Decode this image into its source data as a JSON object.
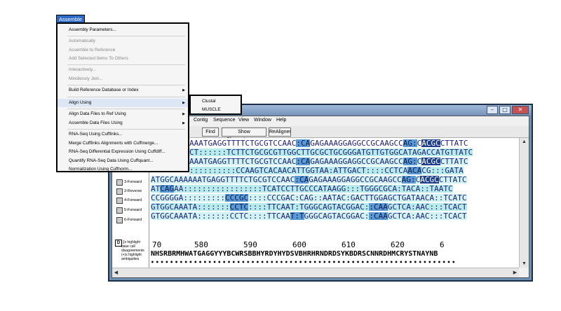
{
  "window": {
    "controls": {
      "minimize": "–",
      "maximize": "□",
      "close": "✕"
    }
  },
  "menubar": [
    "Contig",
    "Sequence",
    "View",
    "Window",
    "Help"
  ],
  "toolbar": {
    "find": "Find",
    "chromatograms": "Show Chromatograms",
    "realign": "ReAligner"
  },
  "assemble_menu": {
    "title": "Assemble",
    "items": {
      "params": "Assembly Parameters...",
      "auto": "Automatically",
      "to_ref": "Assemble to Reference",
      "add_selected": "Add Selected Items To Others",
      "interactive": "Interactively...",
      "mindless": "Mindlessly Join...",
      "build_ref": "Build Reference Database or Index",
      "align_using": "Align Using",
      "align_data": "Align Data Files to Ref Using",
      "assemble_data": "Assemble Data Files Using",
      "rnaseq_cufflinks": "RNA-Seq Using Cufflinks...",
      "merge_cufflinks": "Merge Cufflinks Alignments with Cuffmerge...",
      "rnaseq_cuffdiff": "RNA-Seq Differential Expression Using Cuffdiff...",
      "quantify": "Quantify RNA-Seq Data Using Cuffquant...",
      "normalize": "Normalization Using Cuffnorm..."
    }
  },
  "align_submenu": {
    "clustal": "Clustal",
    "muscle": "MUSCLE"
  },
  "reads": [
    "3-Forward",
    "3-Reverse",
    "4-Forward",
    "5-Forward",
    "6-Forward"
  ],
  "legend": "[-]s highlight base call disagreements (+)s highlight ambiguities",
  "sequences": [
    "AAATGAGGTTTTCTGCGTCCAAC:CAGAGAAAGGAGGCCGCAAGCCAG:CACGCCTTATC",
    "CT::::::TCTTCTGCGCGTTGGCTTGCGCTGCGGGATGTTGTGGCATAGACCATGTTATC",
    "AAATGAGGTTTTCTGCGTCCAAC:CAGAGAAAGGAGGCCGCAAGCCAG:CACGCCTTATC",
    "::::::::::CCAAGTCACAACATTGGTAA:ATTGACT::::CCTCAACACG:::GATA",
    "ATGGCAAAAAATGAGGTTTTCTGCGTCCAAC:CAGAGAAAGGAGGCCGCAAGCCAG:CACGCCTTATC",
    "ATCAGAA:::::::::::::::::TCATCCTTGCCCATAAGG:::TGGGCGCA:TACA::TAATC",
    "CCGGGGA:::::::::CCCGC::::CCCGAC:CAG::AATAC:GACTTGGAGCTGATAACA::TCATC",
    "GTGGCAAATA:::::::CCTC::::TTCAAT:TGGGCAGTACGGAC::CAAGCTCA:AAC:::TCACT",
    "GTGGCAAATA:::::::CCTC::::TTCAAT:TGGGCAGTACGGAC::CAAGCTCA:AAC:::TCACT"
  ],
  "ruler": [
    "70",
    "580",
    "590",
    "600",
    "610",
    "620",
    "6"
  ],
  "consensus": "NHSRBRMHWATGAGGYYYBCWRSBBHYRDYHYDSVBHRHRNDRDSYKBDRSCNNRDHMCRYSTNAYNB",
  "dots": "••••••••••••••••••••••••••••••••••••••••••••••••••••••••••••••••"
}
